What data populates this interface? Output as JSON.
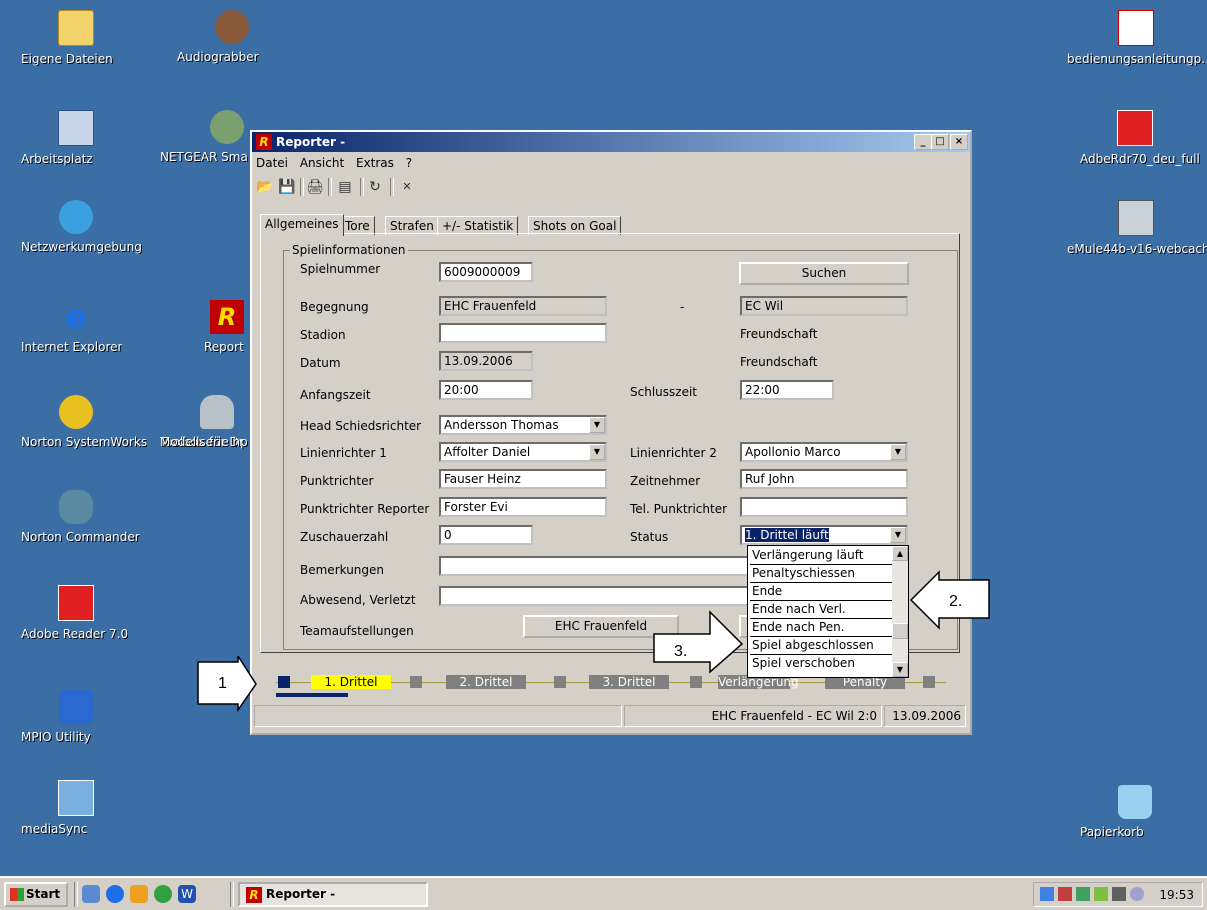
{
  "desktop": {
    "icons_left": [
      {
        "label": "Eigene Dateien",
        "icon": "folder-icon"
      },
      {
        "label": "Audiograbber",
        "icon": "audiograbber-icon"
      },
      {
        "label": "Arbeitsplatz",
        "icon": "computer-icon"
      },
      {
        "label": "NETGEAR Sma",
        "icon": "netgear-icon"
      },
      {
        "label": "Netzwerkumgebung",
        "icon": "network-icon"
      },
      {
        "label": "Internet Explorer",
        "icon": "ie-icon"
      },
      {
        "label": "Report",
        "icon": "reporter-icon"
      },
      {
        "label": "Norton SystemWorks",
        "icon": "norton-icon"
      },
      {
        "label": "Toolbox für Dr",
        "icon": "toolbox-icon"
      },
      {
        "label": "Modellserie hp",
        "icon": ""
      },
      {
        "label": "Norton Commander",
        "icon": "commander-icon"
      },
      {
        "label": "Adobe Reader 7.0",
        "icon": "adobe-icon"
      },
      {
        "label": "MPIO Utility",
        "icon": "mpio-icon"
      },
      {
        "label": "mediaSync",
        "icon": "mediasync-icon"
      }
    ],
    "icons_right": [
      {
        "label": "bedienungsanleitungp…",
        "icon": "pdf-icon"
      },
      {
        "label": "AdbeRdr70_deu_full",
        "icon": "adobe-installer-icon"
      },
      {
        "label": "eMule44b-v16-webcache",
        "icon": "emule-icon"
      },
      {
        "label": "Papierkorb",
        "icon": "recycle-bin-icon"
      }
    ]
  },
  "window": {
    "title": "Reporter -",
    "logo": "R",
    "buttons": {
      "minimize": "_",
      "maximize": "□",
      "close": "×"
    },
    "menu": [
      "Datei",
      "Ansicht",
      "Extras",
      "?"
    ],
    "tabs": [
      "Allgemeines",
      "Tore",
      "Strafen",
      "+/- Statistik",
      "Shots on Goal"
    ],
    "group_title": "Spielinformationen",
    "labels": {
      "spielnummer": "Spielnummer",
      "begegnung": "Begegnung",
      "stadion": "Stadion",
      "datum": "Datum",
      "anfangszeit": "Anfangszeit",
      "schlusszeit": "Schlusszeit",
      "head_sr": "Head Schiedsrichter",
      "linien1": "Linienrichter 1",
      "linien2": "Linienrichter 2",
      "punktrichter": "Punktrichter",
      "zeitnehmer": "Zeitnehmer",
      "pr_reporter": "Punktrichter Reporter",
      "tel_pr": "Tel. Punktrichter",
      "zuschauer": "Zuschauerzahl",
      "status": "Status",
      "bemerkungen": "Bemerkungen",
      "abwesend": "Abwesend, Verletzt",
      "teamaufstellungen": "Teamaufstellungen",
      "dash": "-"
    },
    "values": {
      "spielnummer": "6009000009",
      "home": "EHC Frauenfeld",
      "away": "EC Wil",
      "stadion": "",
      "freundschaft1": "Freundschaft",
      "freundschaft2": "Freundschaft",
      "datum": "13.09.2006",
      "anfangszeit": "20:00",
      "schlusszeit": "22:00",
      "head_sr": "Andersson Thomas",
      "linien1": "Affolter Daniel",
      "linien2": "Apollonio Marco",
      "punktrichter": "Fauser Heinz",
      "zeitnehmer": "Ruf John",
      "pr_reporter": "Forster Evi",
      "tel_pr": "",
      "zuschauer": "0",
      "status": "1. Drittel läuft",
      "bemerkungen": "",
      "abwesend": ""
    },
    "buttons_form": {
      "suchen": "Suchen",
      "team_home": "EHC Frauenfeld"
    },
    "status_options": [
      "Verlängerung läuft",
      "Penaltyschiessen",
      "Ende",
      "Ende nach Verl.",
      "Ende nach Pen.",
      "Spiel abgeschlossen",
      "Spiel verschoben"
    ],
    "timeline": [
      "1. Drittel",
      "2. Drittel",
      "3. Drittel",
      "Verlängerung",
      "Penalty"
    ],
    "statusbar": {
      "match": "EHC Frauenfeld - EC Wil  2:0",
      "date": "13.09.2006"
    }
  },
  "callouts": [
    "1",
    "2.",
    "3."
  ],
  "taskbar": {
    "start": "Start",
    "task": "Reporter -",
    "clock": "19:53"
  }
}
